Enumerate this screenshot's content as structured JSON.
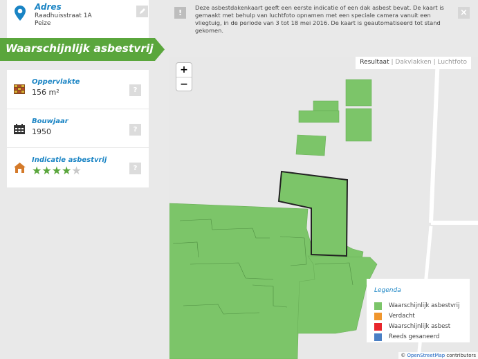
{
  "address": {
    "label": "Adres",
    "street": "Raadhuisstraat 1A",
    "city": "Peize"
  },
  "result_banner": "Waarschijnlijk asbestvrij",
  "info": [
    {
      "title": "Oppervlakte",
      "value": "156 m²",
      "help": "?"
    },
    {
      "title": "Bouwjaar",
      "value": "1950",
      "help": "?"
    },
    {
      "title": "Indicatie asbestvrij",
      "rating": 4,
      "max": 5,
      "help": "?"
    }
  ],
  "notice": {
    "icon": "!",
    "text": "Deze asbestdakenkaart geeft een eerste indicatie of een dak asbest bevat. De kaart is gemaakt met behulp van luchtfoto opnamen met een speciale camera vanuit een vliegtuig, in de periode van 3 tot 18 mei 2016. De kaart is geautomatiseerd tot stand gekomen.",
    "close": "×"
  },
  "map": {
    "layers": {
      "active": "Resultaat",
      "sep": "|",
      "other1": "Dakvlakken",
      "other2": "Luchtfoto"
    },
    "zoom_in": "+",
    "zoom_out": "−",
    "legend": {
      "title": "Legenda",
      "items": [
        {
          "label": "Waarschijnlijk asbestvrij",
          "color": "#7cc569"
        },
        {
          "label": "Verdacht",
          "color": "#f0962e"
        },
        {
          "label": "Waarschijnlijk asbest",
          "color": "#e8262c"
        },
        {
          "label": "Reeds gesaneerd",
          "color": "#4a7fc4"
        }
      ]
    },
    "attribution": {
      "prefix": "© ",
      "link": "OpenStreetMap",
      "suffix": " contributors"
    }
  },
  "colors": {
    "accent": "#1a84c4",
    "banner": "#5aa63c",
    "roof_green": "#7cc569"
  }
}
